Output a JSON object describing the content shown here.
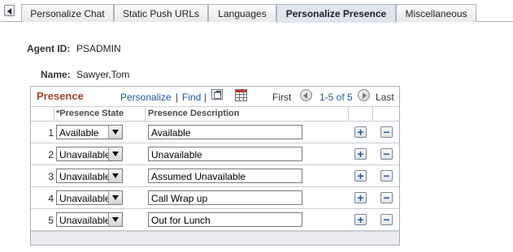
{
  "tabs": [
    {
      "label": "Personalize Chat",
      "active": false
    },
    {
      "label": "Static Push URLs",
      "active": false
    },
    {
      "label": "Languages",
      "active": false
    },
    {
      "label": "Personalize Presence",
      "active": true
    },
    {
      "label": "Miscellaneous",
      "active": false
    }
  ],
  "agent": {
    "id_label": "Agent ID:",
    "id_value": "PSADMIN",
    "name_label": "Name:",
    "name_value": "Sawyer,Tom"
  },
  "grid": {
    "title": "Presence",
    "personalize_link": "Personalize",
    "find_link": "Find",
    "separator": "|",
    "first_label": "First",
    "range": "1-5 of 5",
    "last_label": "Last",
    "columns": {
      "state": "*Presence State",
      "description": "Presence Description"
    },
    "rows": [
      {
        "num": "1",
        "state": "Available",
        "description": "Available"
      },
      {
        "num": "2",
        "state": "Unavailable",
        "description": "Unavailable"
      },
      {
        "num": "3",
        "state": "Unavailable",
        "description": "Assumed Unavailable"
      },
      {
        "num": "4",
        "state": "Unavailable",
        "description": "Call Wrap up"
      },
      {
        "num": "5",
        "state": "Unavailable",
        "description": "Out for Lunch"
      }
    ],
    "add_glyph": "+",
    "delete_glyph": "−"
  },
  "colors": {
    "grid_title": "#a0462b",
    "link": "#1b57a6",
    "active_tab": "#dfe5ee"
  }
}
